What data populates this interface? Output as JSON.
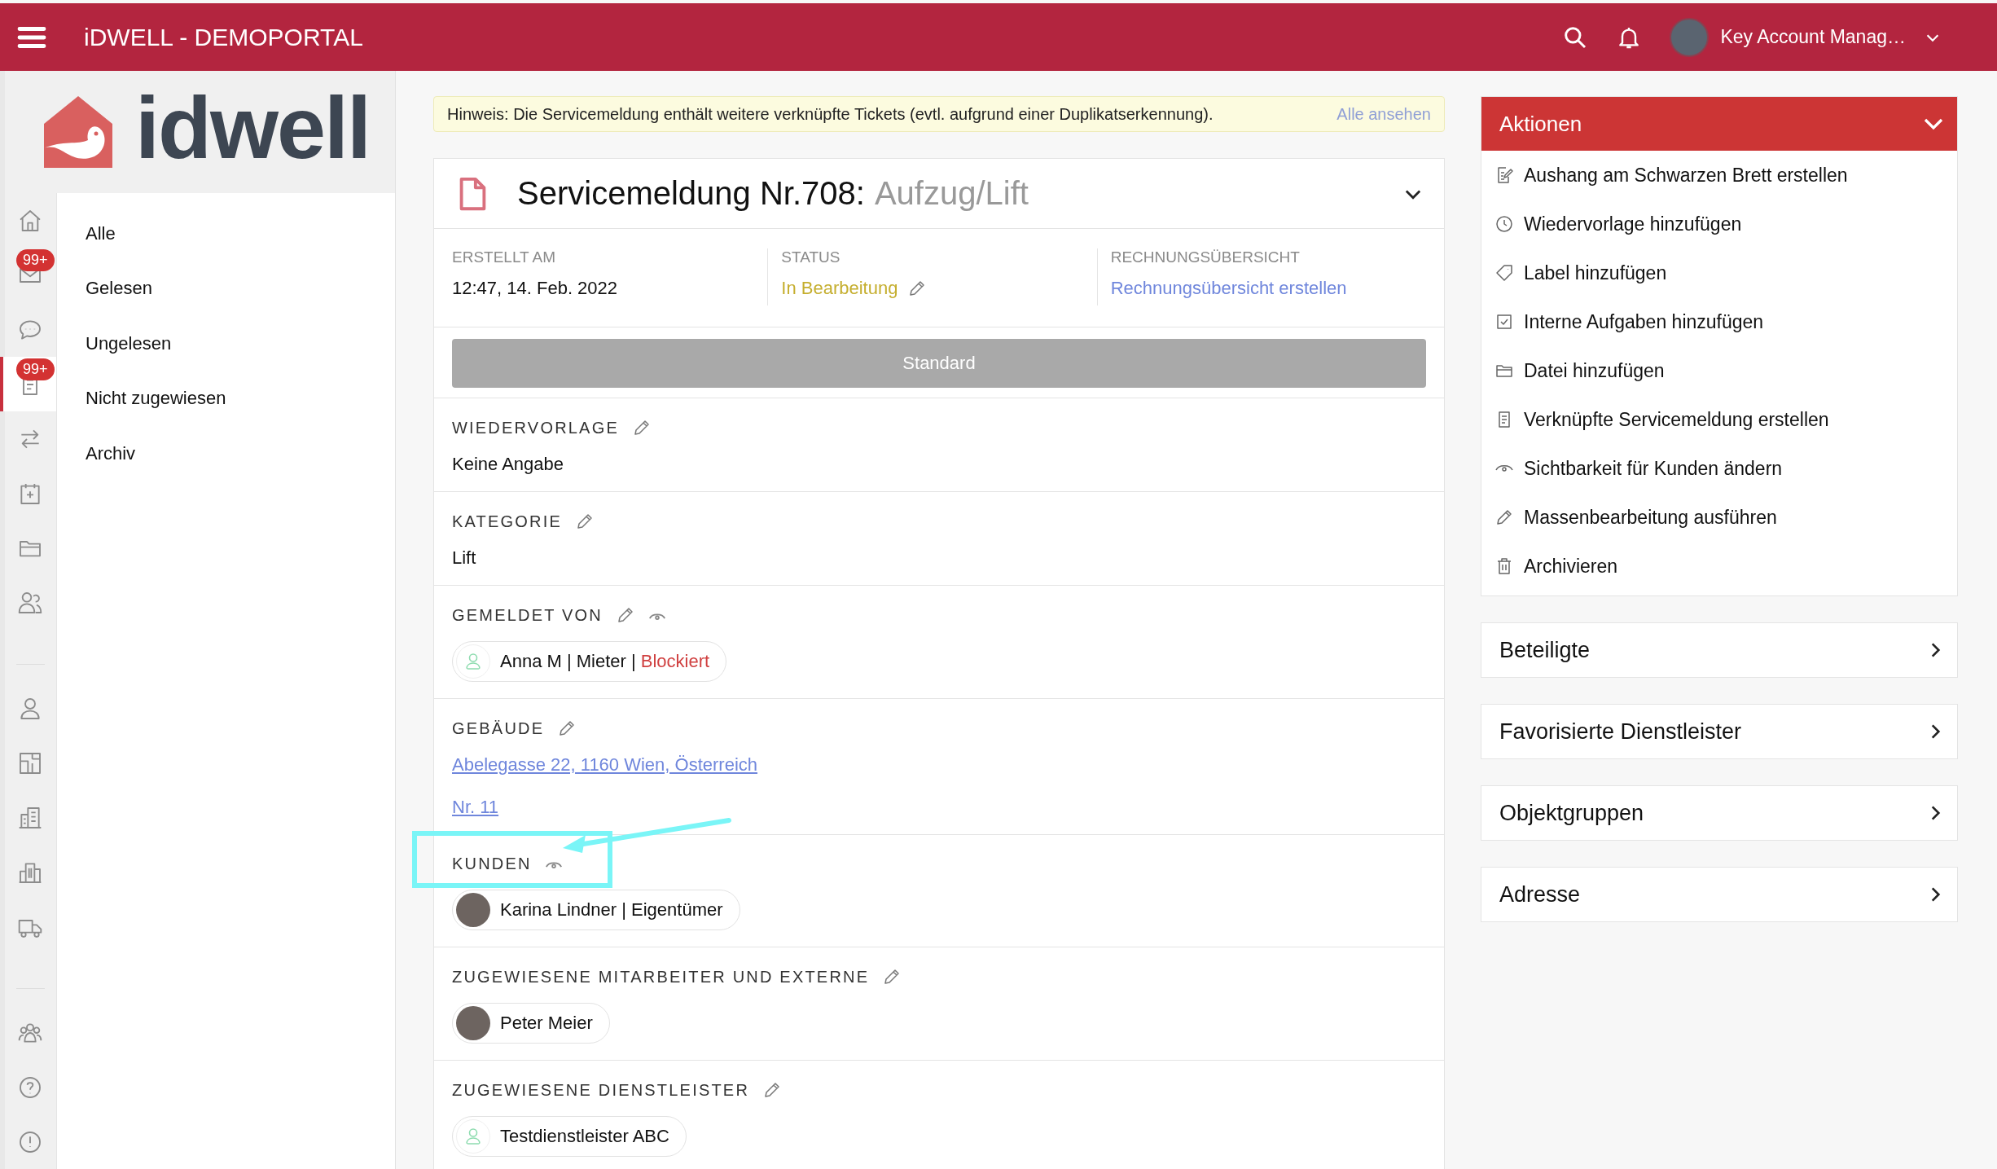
{
  "app_bar": {
    "title": "iDWELL - DEMOPORTAL",
    "user": "Key Account Manag…"
  },
  "logo": {
    "text": "idwell"
  },
  "nav_rail": {
    "groups": [
      [
        {
          "selected": false
        },
        {
          "selected": false,
          "badge": "99+"
        },
        {
          "selected": false
        },
        {
          "selected": true,
          "badge": "99+"
        },
        {
          "selected": false
        },
        {
          "selected": false
        },
        {
          "selected": false
        },
        {
          "selected": false
        }
      ],
      [
        {
          "selected": false
        },
        {
          "selected": false
        },
        {
          "selected": false
        },
        {
          "selected": false
        },
        {
          "selected": false
        }
      ],
      [
        {
          "selected": false
        },
        {
          "selected": false
        },
        {
          "selected": false
        }
      ]
    ]
  },
  "submenu": [
    {
      "label": "Alle",
      "selected": false
    },
    {
      "label": "Gelesen",
      "selected": false
    },
    {
      "label": "Ungelesen",
      "selected": false
    },
    {
      "label": "Nicht zugewiesen",
      "selected": false
    },
    {
      "label": "Archiv",
      "selected": false
    }
  ],
  "notice": {
    "text": "Hinweis: Die Servicemeldung enthält weitere verknüpfte Tickets (evtl. aufgrund einer Duplikatserkennung).",
    "link": "Alle ansehen"
  },
  "ticket": {
    "title": "Servicemeldung Nr.708:",
    "subtitle": "Aufzug/Lift",
    "expanded": true,
    "meta": [
      {
        "label": "ERSTELLT AM",
        "value": "12:47, 14. Feb. 2022",
        "kind": "text"
      },
      {
        "label": "STATUS",
        "value": "In Bearbeitung",
        "kind": "status"
      },
      {
        "label": "RECHNUNGSÜBERSICHT",
        "value": "Rechnungsübersicht erstellen",
        "kind": "link"
      }
    ],
    "priority_button": "Standard",
    "sections": [
      {
        "label": "WIEDERVORLAGE",
        "editable": true,
        "visibility": false,
        "highlighted": false,
        "kind": "text",
        "value": "Keine Angabe"
      },
      {
        "label": "KATEGORIE",
        "editable": true,
        "visibility": false,
        "highlighted": false,
        "kind": "text",
        "value": "Lift"
      },
      {
        "label": "GEMELDET VON",
        "editable": true,
        "visibility": true,
        "highlighted": false,
        "kind": "chips",
        "chips": [
          {
            "photo": false,
            "text": "Anna M | Mieter |",
            "flag": "Blockiert"
          }
        ]
      },
      {
        "label": "GEBÄUDE",
        "editable": true,
        "visibility": false,
        "highlighted": false,
        "kind": "links",
        "links": [
          "Abelegasse 22, 1160 Wien, Österreich",
          "Nr. 11"
        ]
      },
      {
        "label": "KUNDEN",
        "editable": false,
        "visibility": true,
        "highlighted": true,
        "kind": "chips",
        "chips": [
          {
            "photo": true,
            "text": "Karina Lindner | Eigentümer"
          }
        ]
      },
      {
        "label": "ZUGEWIESENE MITARBEITER UND EXTERNE",
        "editable": true,
        "visibility": false,
        "highlighted": false,
        "kind": "chips",
        "chips": [
          {
            "photo": true,
            "text": "Peter Meier"
          }
        ]
      },
      {
        "label": "ZUGEWIESENE DIENSTLEISTER",
        "editable": true,
        "visibility": false,
        "highlighted": false,
        "kind": "chips",
        "chips": [
          {
            "photo": false,
            "text": "Testdienstleister ABC"
          }
        ]
      }
    ]
  },
  "actions": {
    "title": "Aktionen",
    "expanded": true,
    "items": [
      "Aushang am Schwarzen Brett erstellen",
      "Wiedervorlage hinzufügen",
      "Label hinzufügen",
      "Interne Aufgaben hinzufügen",
      "Datei hinzufügen",
      "Verknüpfte Servicemeldung erstellen",
      "Sichtbarkeit für Kunden ändern",
      "Massenbearbeitung ausführen",
      "Archivieren"
    ]
  },
  "panels": [
    {
      "title": "Beteiligte",
      "expanded": false
    },
    {
      "title": "Favorisierte Dienstleister",
      "expanded": false
    },
    {
      "title": "Objektgruppen",
      "expanded": false
    },
    {
      "title": "Adresse",
      "expanded": false
    }
  ]
}
